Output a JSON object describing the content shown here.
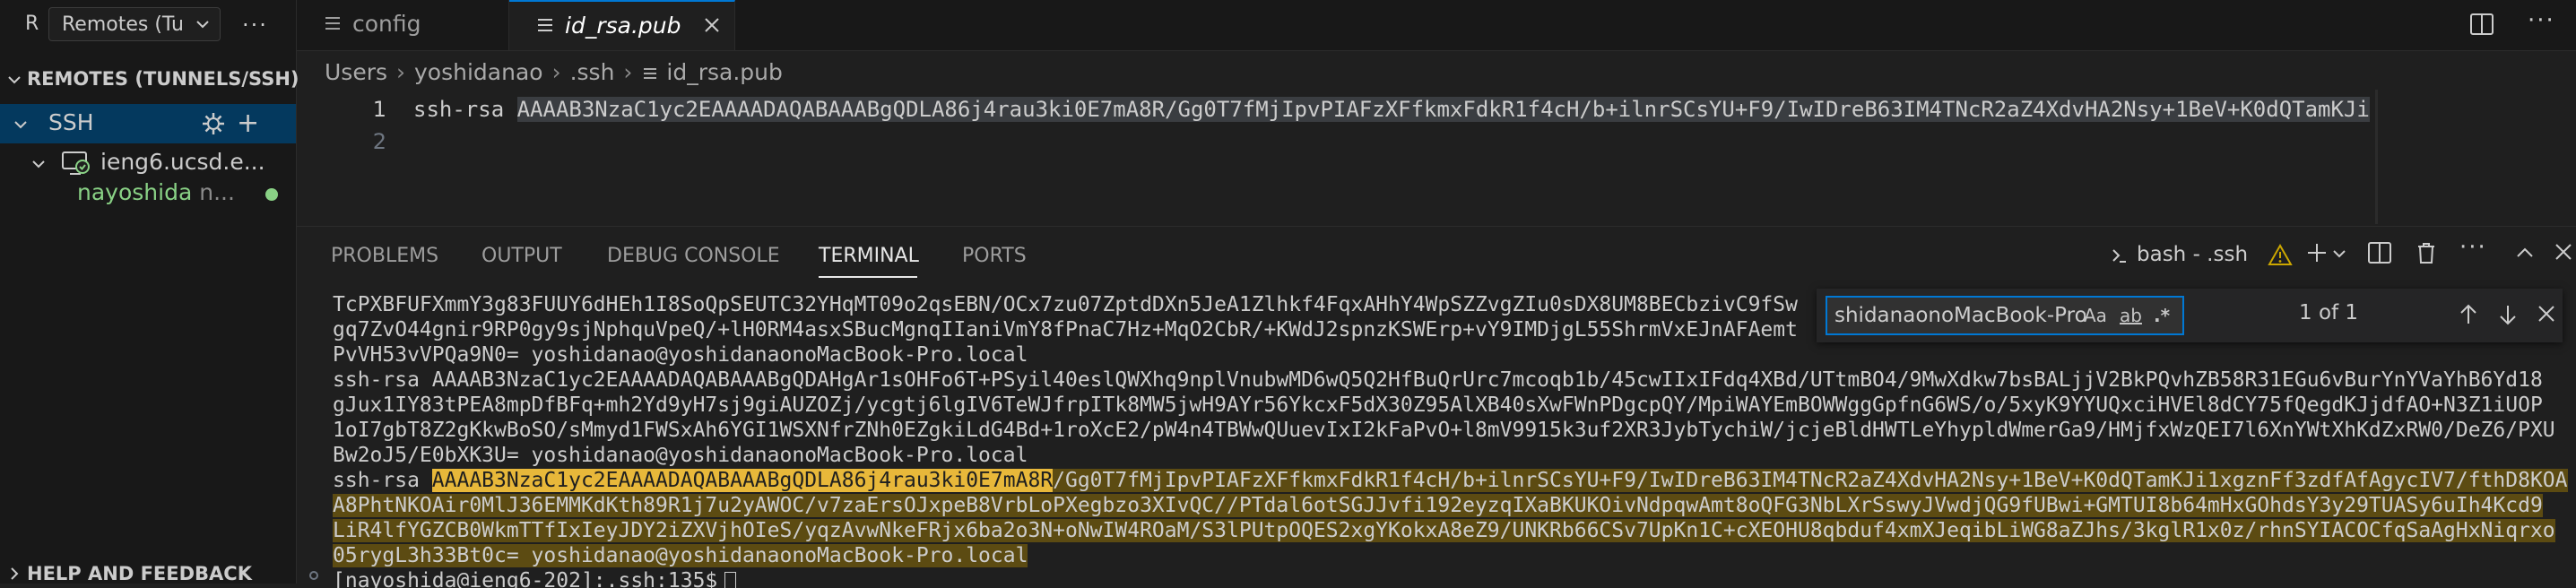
{
  "sidebar": {
    "activity_letter": "R",
    "remote_select": {
      "label": "Remotes (Tu",
      "label_fade": "nnels/SSH)"
    },
    "section_title": "REMOTES (TUNNELS/SSH)",
    "ssh_group": "SSH",
    "host": "ieng6.ucsd.e...",
    "connection": {
      "label": "nayoshida",
      "sub": "n..."
    },
    "help_title": "HELP AND FEEDBACK"
  },
  "tabs": [
    {
      "name": "config"
    },
    {
      "name": "id_rsa.pub"
    }
  ],
  "breadcrumb": [
    "Users",
    "yoshidanao",
    ".ssh",
    "id_rsa.pub"
  ],
  "editor": {
    "line_numbers": [
      "1",
      "2"
    ],
    "line1_prefix": "ssh-rsa ",
    "line1_key": "AAAAB3NzaC1yc2EAAAADAQABAAABgQDLA86j4rau3ki0E7mA8R/Gg0T7fMjIpvPIAFzXFfkmxFdkR1f4cH/b+ilnrSCsYU+F9/IwIDreB63IM4TNcR2aZ4XdvHA2Nsy+1BeV+K0dQTamKJi"
  },
  "panel": {
    "tabs": [
      "PROBLEMS",
      "OUTPUT",
      "DEBUG CONSOLE",
      "TERMINAL",
      "PORTS"
    ],
    "terminal_name": "bash - .ssh"
  },
  "terminal": {
    "lines": [
      "TcPXBFUFXmmY3g83FUUY6dHEh1I8SoQpSEUTC32YHqMT09o2qsEBN/OCx7zu07ZptdDXn5JeA1Zlhkf4FqxAHhY4WpSZZvgZIu0sDX8UM8BECbzivC9fSw",
      "gq7ZvO44gnir9RP0gy9sjNphquVpeQ/+lH0RM4asxSBucMgnqIIaniVmY8fPnaC7Hz+MqO2CbR/+KWdJ2spnzKSWErp+vY9IMDjgL55ShrmVxEJnAFAemt",
      "PvVH53vVPQa9N0= yoshidanao@yoshidanaonoMacBook-Pro.local",
      "ssh-rsa AAAAB3NzaC1yc2EAAAADAQABAAABgQDAHgAr1sOHFo6T+PSyil40eslQWXhq9nplVnubwMD6wQ5Q2HfBuQrUrc7mcoqb1b/45cwIIxIFdq4XBd/UTtmBO4/9MwXdkw7bsBALjjV2BkPQvhZB58R31EGu6vBurYnYVaYhB6Yd18",
      "gJux1IY83tPEA8mpDfBFq+mh2Yd9yH7sj9giAUZOZj/ycgtj6lgIV6TeWJfrpITk8MW5jwH9AYr56YkcxF5dX30Z95AlXB40sXwFWnPDgcpQY/MpiWAYEmBOWWggGpfnG6WS/o/5xyK9YYUQxciHVEl8dCY75fQegdKJjdfAO+N3Z1iUOP",
      "1oI7gbT8Z2gKkwBoSO/sMmyd1FWSxAh6YGI1WSXNfrZNh0EZgkiLdG4Bd+1roXcE2/pW4n4TBWwQUuevIxI2kFaPvO+l8mV9915k3uf2XR3JybTychiW/jcjeBldHWTLeYhypldWmerGa9/HMjfxWzQEI7l6XnYWtXhKdZxRW0/DeZ6/PXU",
      "Bw2oJ5/E0bXK3U= yoshidanao@yoshidanaonoMacBook-Pro.local",
      "A8PhtNKOAir0MlJ36EMMKdKth89R1j7u2yAWOC/v7zaErsOJxpeB8VrbLoPXegbzo3XIvQC//PTdal6otSGJJvfi192eyzqIXaBKUKOivNdpqwAmt8oQFG3NbLXrSswyJVwdjQG9fUBwi+GMTUI8b64mHxGOhdsY3y29TUASy6uIh4Kcd9",
      "LiR4lfYGZCB0WkmTTfIxIeyJDY2iZXVjhOIeS/yqzAvwNkeFRjx6ba2o3N+oNwIW4ROaM/S3lPUtpOQES2xgYKokxA8eZ9/UNKRb66CSv7UpKn1C+cXEOHU8qbduf4xmXJeqibLiWG8aZJhs/3kglR1x0z/rhnSYIACOCfqSaAgHxNiqrxo",
      "05rygL3h33Bt0c= yoshidanao@yoshidanaonoMacBook-Pro.local",
      "[nayoshida@ieng6-202]:.ssh:135$"
    ],
    "match_prefix": "ssh-rsa ",
    "match_current": "AAAAB3NzaC1yc2EAAAADAQABAAABgQDLA86j4rau3ki0E7mA8R",
    "match_rest": "/Gg0T7fMjIpvPIAFzXFfkmxFdkR1f4cH/b+ilnrSCsYU+F9/IwIDreB63IM4TNcR2aZ4XdvHA2Nsy+1BeV+K0dQTamKJi1xgznFf3zdfAfAgycIV7/fthD8KOA"
  },
  "find": {
    "value": "shidanaonoMacBook-Pro.local",
    "opt_case": "Aa",
    "opt_word": "ab",
    "opt_regex": ".*",
    "count": "1 of 1"
  }
}
